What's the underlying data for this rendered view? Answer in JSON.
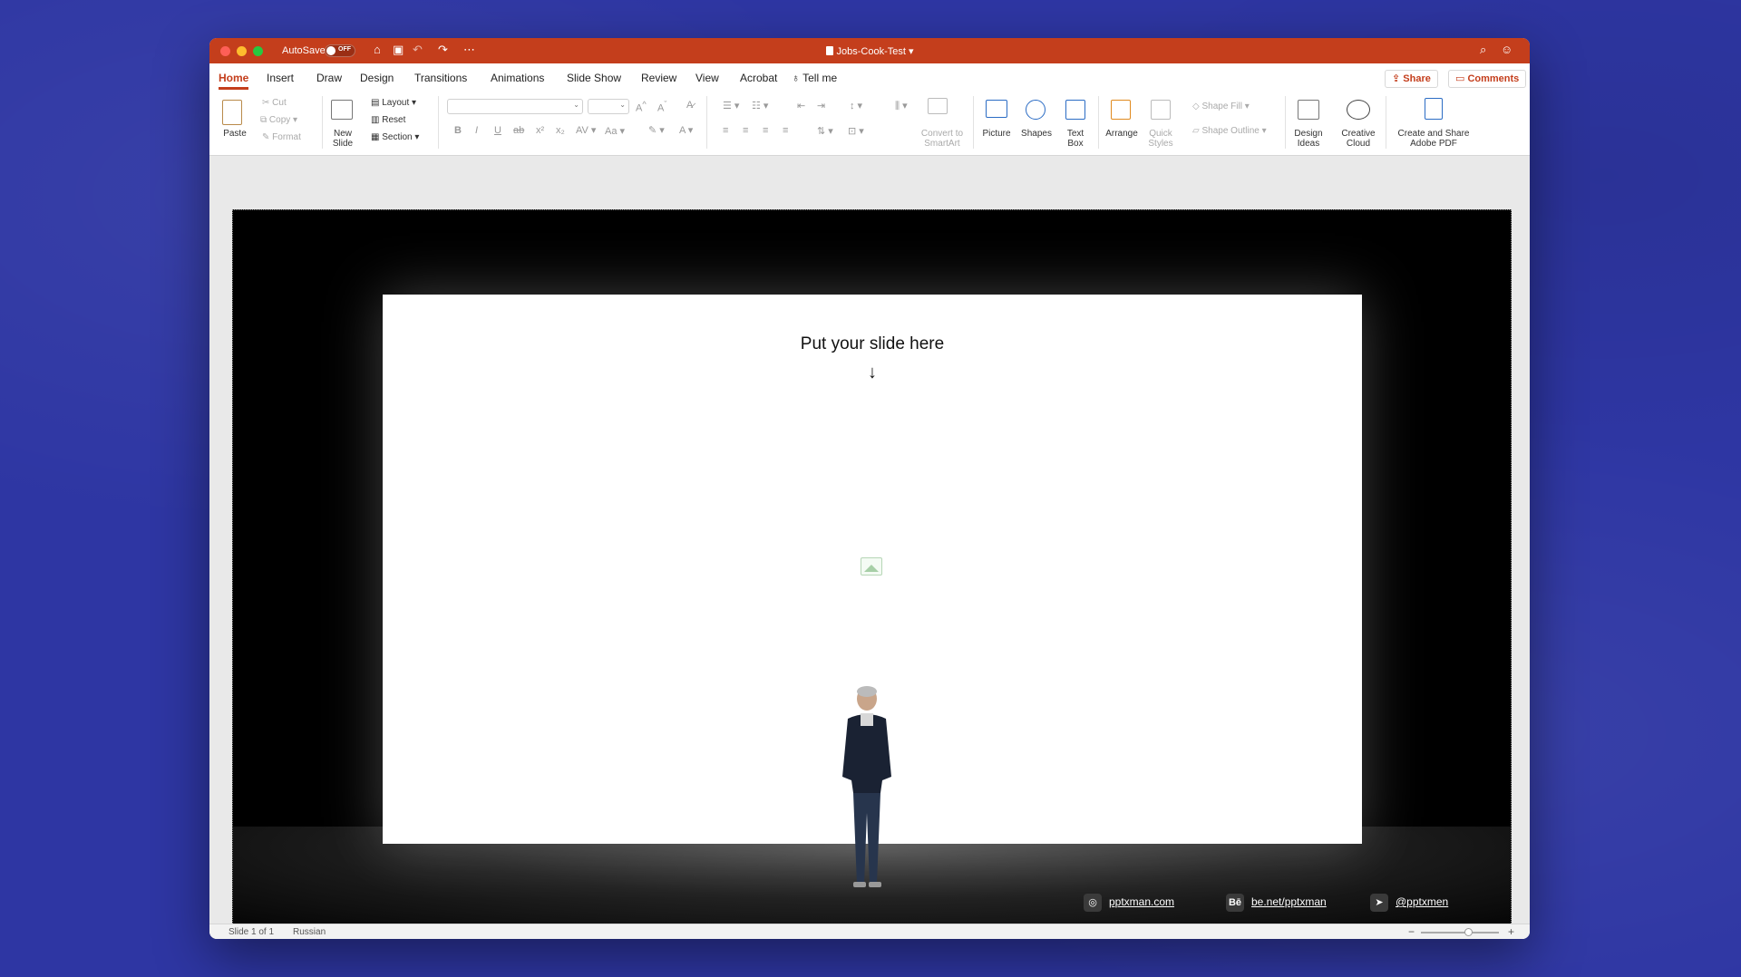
{
  "titlebar": {
    "autosave_label": "AutoSave",
    "autosave_state": "OFF",
    "document_title": "Jobs-Cook-Test"
  },
  "tabs": [
    "Home",
    "Insert",
    "Draw",
    "Design",
    "Transitions",
    "Animations",
    "Slide Show",
    "Review",
    "View",
    "Acrobat"
  ],
  "tell_me": "Tell me",
  "share_label": "Share",
  "comments_label": "Comments",
  "ribbon": {
    "paste": "Paste",
    "cut": "Cut",
    "copy": "Copy",
    "format": "Format",
    "new_slide": "New\nSlide",
    "layout": "Layout",
    "reset": "Reset",
    "section": "Section",
    "convert_smartart": "Convert to\nSmartArt",
    "picture": "Picture",
    "shapes": "Shapes",
    "text_box": "Text\nBox",
    "arrange": "Arrange",
    "quick_styles": "Quick\nStyles",
    "shape_fill": "Shape Fill",
    "shape_outline": "Shape Outline",
    "design_ideas": "Design\nIdeas",
    "creative_cloud": "Creative\nCloud",
    "create_share_pdf": "Create and Share\nAdobe PDF"
  },
  "slide": {
    "title": "Put your slide here",
    "arrow": "↓",
    "links": [
      {
        "icon": "globe-icon",
        "glyph": "◎",
        "text": "pptxman.com"
      },
      {
        "icon": "behance-icon",
        "glyph": "Bē",
        "text": "be.net/pptxman"
      },
      {
        "icon": "telegram-icon",
        "glyph": "➤",
        "text": "@pptxmen"
      }
    ]
  },
  "status": {
    "slide_count": "Slide 1 of 1",
    "language": "Russian",
    "zoom_minus": "−",
    "zoom_plus": "+"
  },
  "colors": {
    "accent": "#c43e1c",
    "background": "#2e36a3"
  }
}
